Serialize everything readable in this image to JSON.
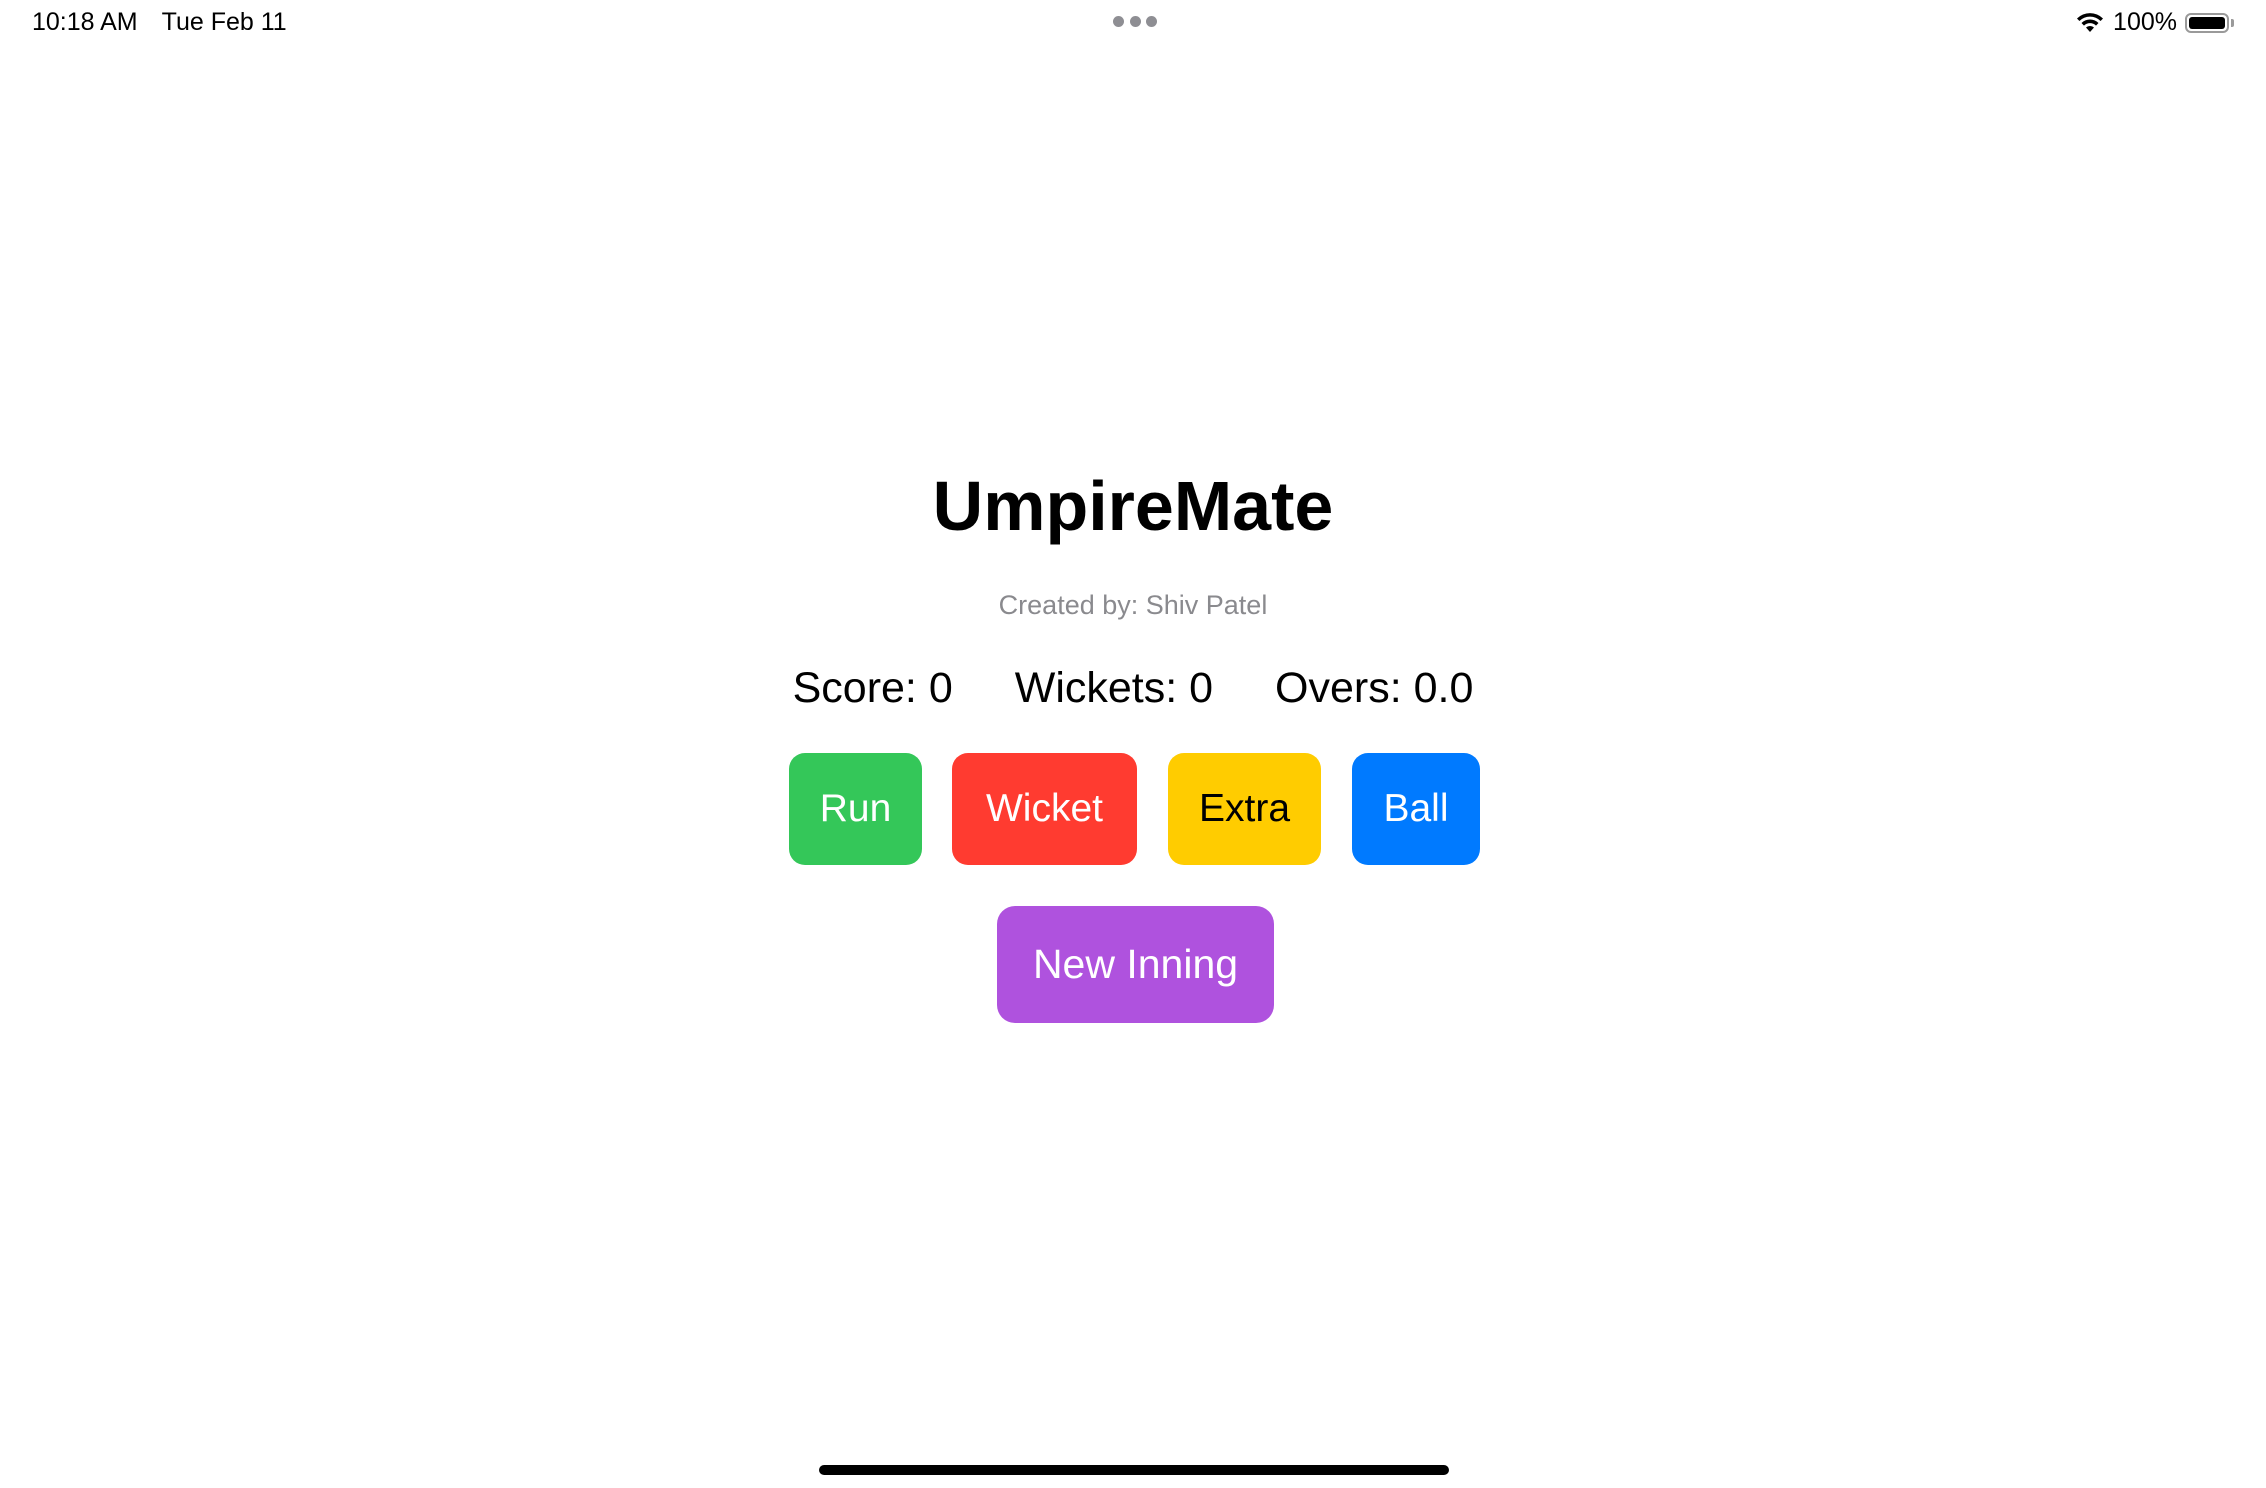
{
  "status_bar": {
    "time": "10:18 AM",
    "date": "Tue Feb 11",
    "battery_percent": "100%",
    "battery_level": 1.0,
    "icons": [
      "wifi-icon",
      "battery-icon",
      "multitasking-dots-icon"
    ]
  },
  "app": {
    "title": "UmpireMate",
    "subtitle": "Created by: Shiv Patel"
  },
  "stats": {
    "score": "Score: 0",
    "wickets": "Wickets: 0",
    "overs": "Overs: 0.0"
  },
  "buttons": {
    "run": {
      "label": "Run",
      "color": "#34C759",
      "text_color": "#ffffff"
    },
    "wicket": {
      "label": "Wicket",
      "color": "#FF3B30",
      "text_color": "#ffffff"
    },
    "extra": {
      "label": "Extra",
      "color": "#FFCC00",
      "text_color": "#000000"
    },
    "ball": {
      "label": "Ball",
      "color": "#007AFF",
      "text_color": "#ffffff"
    },
    "new_inning": {
      "label": "New Inning",
      "color": "#AF52DE",
      "text_color": "#ffffff"
    }
  }
}
